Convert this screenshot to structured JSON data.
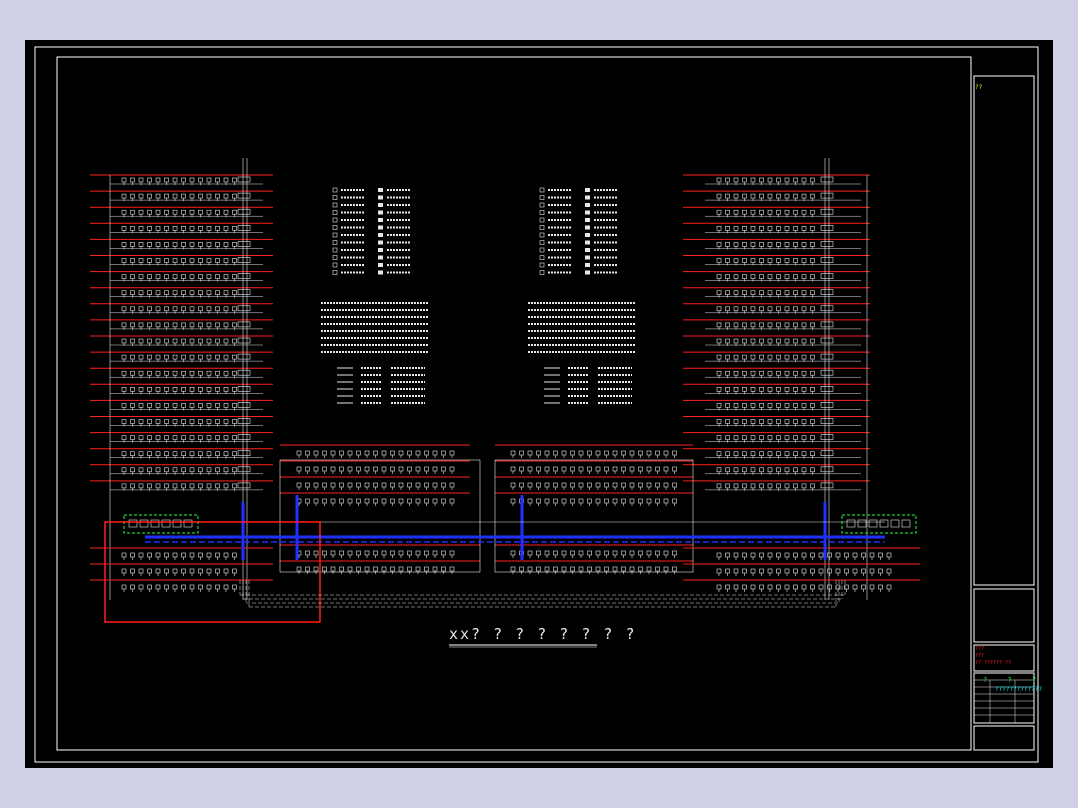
{
  "drawing": {
    "title": "xx? ? ? ? ? ? ? ?",
    "stamp": "??",
    "title_block": {
      "row1": "???",
      "row2": "???",
      "row3": "?? ?????? ??",
      "header": "? ? ?",
      "cyan_note": "?????????????"
    }
  },
  "colors": {
    "background": "#000000",
    "frame": "#ffffff",
    "bus": "#ff2020",
    "trunk": "#2030ff",
    "device": "#e8e8e8",
    "panel": "#20ff40",
    "highlight": "#ff2020"
  }
}
